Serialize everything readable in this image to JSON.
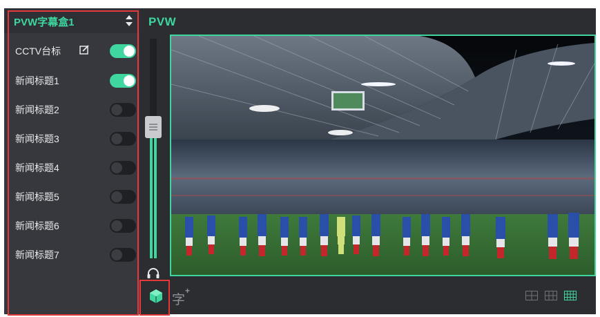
{
  "panel": {
    "title": "PVW字幕盒1",
    "items": [
      {
        "label": "CCTV台标",
        "on": true,
        "editable": true
      },
      {
        "label": "新闻标题1",
        "on": true
      },
      {
        "label": "新闻标题2",
        "on": false
      },
      {
        "label": "新闻标题3",
        "on": false
      },
      {
        "label": "新闻标题4",
        "on": false
      },
      {
        "label": "新闻标题5",
        "on": false
      },
      {
        "label": "新闻标题6",
        "on": false
      },
      {
        "label": "新闻标题7",
        "on": false
      }
    ]
  },
  "preview": {
    "label": "PVW",
    "image": "stadium-team-celebration"
  },
  "fader": {
    "level": 0.64
  },
  "toolbar": {
    "subtitle_glyph": "字",
    "subtitle_plus": "+",
    "icons": [
      "cube-icon",
      "subtitle-add-icon",
      "layout-2x2-icon",
      "layout-3x2-icon",
      "layout-4x3-icon"
    ]
  },
  "colors": {
    "accent": "#3fd6a0",
    "annotation": "#e23a3a",
    "panel": "#36383e"
  }
}
